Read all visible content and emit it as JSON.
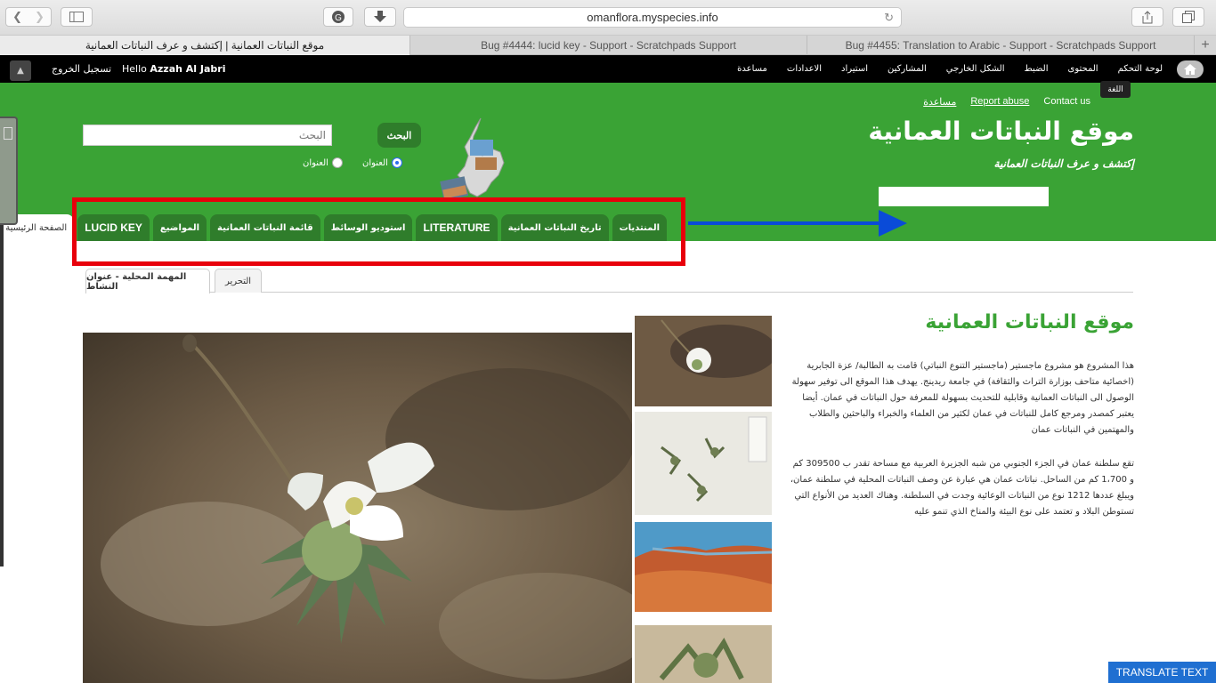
{
  "browser": {
    "url": "omanflora.myspecies.info",
    "tabs": [
      {
        "title": "موقع النباتات العمانية | إكتشف و عرف النباتات العمانية"
      },
      {
        "title": "Bug #4444: lucid key - Support - Scratchpads Support"
      },
      {
        "title": "Bug #4455: Translation to Arabic - Support - Scratchpads Support"
      }
    ]
  },
  "admin_bar": {
    "logout": "تسجيل الخروج",
    "hello_prefix": "Hello",
    "user_name": "Azzah Al Jabri",
    "menu": [
      "لوحة التحكم",
      "المحتوى",
      "الضبط",
      "الشكل الخارجي",
      "المشاركين",
      "استيراد",
      "الاعدادات",
      "مساعدة"
    ],
    "tooltip": "اللغة"
  },
  "header": {
    "links": {
      "help": "مساعدة",
      "report": "Report abuse",
      "contact": "Contact us"
    },
    "title": "موقع النباتات العمانية",
    "slogan": "إكتشف و عرف النباتات العمانية",
    "search_placeholder": "البحث",
    "search_button": "البحث",
    "radio_options": [
      "العنوان",
      "العنوان"
    ]
  },
  "nav_tabs": [
    "المنتديات",
    "تاريخ النباتات العمانية",
    "LITERATURE",
    "استوديو الوسائط",
    "قائمة النباتات العمانية",
    "المواضيع",
    "LUCID KEY",
    "الصفحة الرئيسية"
  ],
  "sub_tabs": {
    "edit": "التحرير",
    "active": "المهمة المحلية - عنوان النشاط"
  },
  "content": {
    "title": "موقع النباتات العمانية",
    "para1": "هذا المشروع هو مشروع ماجستير (ماجستير التنوع النباتي) قامت به الطالبة/ عزة الجابرية (اخصائية متاحف بوزارة التراث والثقافة) في جامعة ريدينج. يهدف هذا الموقع الى توفير سهولة الوصول الى النباتات العمانية وقابلية للتحديث بسهولة للمعرفة حول النباتات في عمان. أيضا يعتبر كمصدر ومرجع كامل للنباتات في عمان لكثير من العلماء والخبراء والباحثين والطلاب والمهتمين في النباتات عمان",
    "para2": "تقع سلطنة عمان في الجزء الجنوبي من شبه الجزيرة العربية مع مساحة تقدر ب 309500 كم و 1،700 كم من الساحل. نباتات عمان هي عبارة عن وصف النباتات المحلية في سلطنة عمان، ويبلغ عددها 1212 نوع من النباتات الوعائية وجدت في السلطنة. وهناك العديد من الأنواع التي تستوطن البلاد و تعتمد على نوع البيئة والمناخ الذي تنمو عليه"
  },
  "translate_button": "TRANSLATE TEXT",
  "colors": {
    "header_green": "#3aa335",
    "tab_green": "#2f7d2b",
    "highlight_red": "#e8000b",
    "arrow_blue": "#0a4bd8"
  }
}
